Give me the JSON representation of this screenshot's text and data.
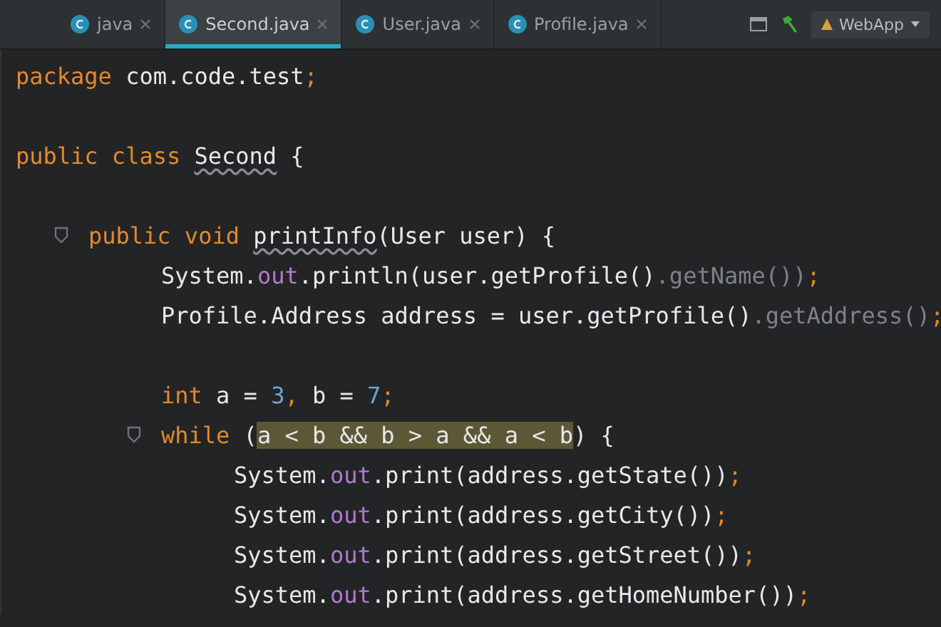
{
  "tabs": [
    {
      "label": "java",
      "selected": false
    },
    {
      "label": "Second.java",
      "selected": true
    },
    {
      "label": "User.java",
      "selected": false
    },
    {
      "label": "Profile.java",
      "selected": false
    }
  ],
  "toolbar": {
    "run_config": "WebApp"
  },
  "code": [
    {
      "kind": "code",
      "tokens": [
        {
          "kind": "keyword",
          "text": "package"
        },
        {
          "kind": "plain",
          "text": " com.code.test"
        },
        {
          "kind": "punct",
          "text": ";"
        }
      ]
    },
    {
      "kind": "blank"
    },
    {
      "kind": "code",
      "tokens": [
        {
          "kind": "keyword",
          "text": "public class "
        },
        {
          "kind": "warn",
          "text": "Second"
        },
        {
          "kind": "plain",
          "text": " {"
        }
      ],
      "children": [
        {
          "kind": "blank"
        },
        {
          "kind": "code",
          "tokens": [
            {
              "kind": "keyword",
              "text": "public void "
            },
            {
              "kind": "warn",
              "text": "printInfo"
            },
            {
              "kind": "plain",
              "text": "(User user) {"
            }
          ],
          "children": [
            {
              "kind": "code",
              "tokens": [
                {
                  "kind": "plain",
                  "text": "System."
                },
                {
                  "kind": "field",
                  "text": "out"
                },
                {
                  "kind": "plain",
                  "text": ".println(user.getProfile()"
                },
                {
                  "kind": "dim",
                  "text": ".getName())"
                },
                {
                  "kind": "punct",
                  "text": ";"
                }
              ]
            },
            {
              "kind": "code",
              "tokens": [
                {
                  "kind": "plain",
                  "text": "Profile.Address address = user.getProfile()"
                },
                {
                  "kind": "dim",
                  "text": ".getAddress()"
                },
                {
                  "kind": "punct",
                  "text": ";"
                }
              ]
            },
            {
              "kind": "blank"
            },
            {
              "kind": "code",
              "tokens": [
                {
                  "kind": "keyword",
                  "text": "int"
                },
                {
                  "kind": "plain",
                  "text": " a = "
                },
                {
                  "kind": "number",
                  "text": "3"
                },
                {
                  "kind": "punct",
                  "text": ","
                },
                {
                  "kind": "plain",
                  "text": " b = "
                },
                {
                  "kind": "number",
                  "text": "7"
                },
                {
                  "kind": "punct",
                  "text": ";"
                }
              ]
            },
            {
              "kind": "code",
              "tokens": [
                {
                  "kind": "keyword",
                  "text": "while"
                },
                {
                  "kind": "plain",
                  "text": " ("
                },
                {
                  "kind": "match",
                  "text": "a < b && b > a && a < b"
                },
                {
                  "kind": "plain",
                  "text": ") {"
                }
              ],
              "children": [
                {
                  "kind": "code",
                  "tokens": [
                    {
                      "kind": "plain",
                      "text": "System."
                    },
                    {
                      "kind": "field",
                      "text": "out"
                    },
                    {
                      "kind": "plain",
                      "text": ".print(address.getState())"
                    },
                    {
                      "kind": "punct",
                      "text": ";"
                    }
                  ]
                },
                {
                  "kind": "code",
                  "tokens": [
                    {
                      "kind": "plain",
                      "text": "System."
                    },
                    {
                      "kind": "field",
                      "text": "out"
                    },
                    {
                      "kind": "plain",
                      "text": ".print(address.getCity())"
                    },
                    {
                      "kind": "punct",
                      "text": ";"
                    }
                  ]
                },
                {
                  "kind": "code",
                  "tokens": [
                    {
                      "kind": "plain",
                      "text": "System."
                    },
                    {
                      "kind": "field",
                      "text": "out"
                    },
                    {
                      "kind": "plain",
                      "text": ".print(address.getStreet())"
                    },
                    {
                      "kind": "punct",
                      "text": ";"
                    }
                  ]
                },
                {
                  "kind": "code",
                  "tokens": [
                    {
                      "kind": "plain",
                      "text": "System."
                    },
                    {
                      "kind": "field",
                      "text": "out"
                    },
                    {
                      "kind": "plain",
                      "text": ".print(address.getHomeNumber())"
                    },
                    {
                      "kind": "punct",
                      "text": ";"
                    }
                  ]
                }
              ]
            }
          ]
        }
      ]
    }
  ]
}
